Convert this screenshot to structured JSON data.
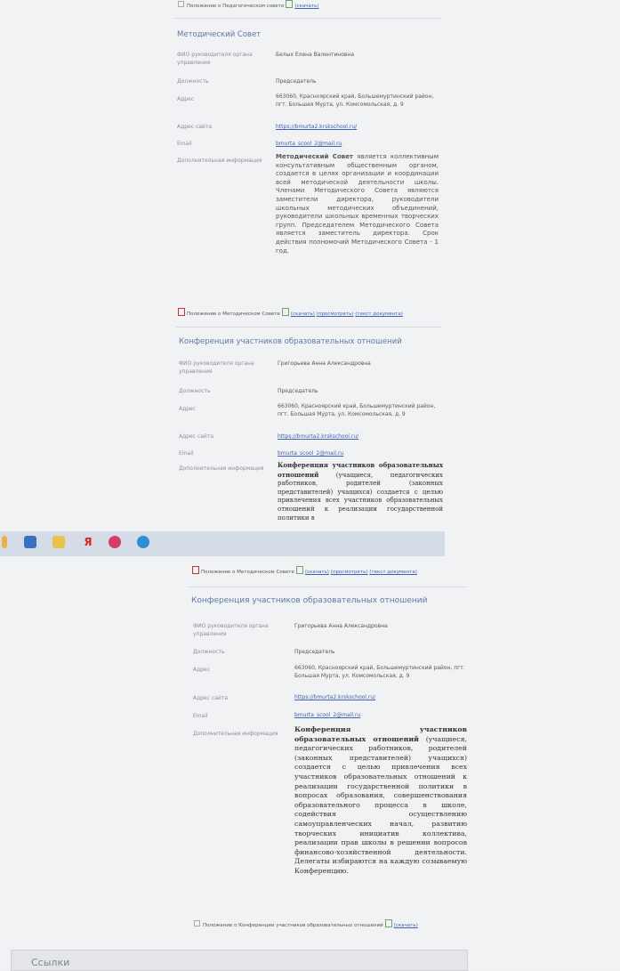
{
  "top_doc": {
    "label": "Положение о Педагогическом совете",
    "action": "(скачать)"
  },
  "metod": {
    "title": "Методический Совет",
    "rows": [
      {
        "label": "ФИО руководителя органа управления",
        "value": "Белых Елена Валентиновна"
      },
      {
        "label": "Должность",
        "value": "Председатель"
      },
      {
        "label": "Адрес",
        "value": "663060, Красноярский край, Большемуртинский район, пгт. Большая Мурта, ул. Комсомольская, д. 9"
      },
      {
        "label": "Адрес сайта",
        "value": "https://bmurta2.krskschool.ru/"
      },
      {
        "label": "Email",
        "value": "bmurta_scool_2@mail.ru"
      },
      {
        "label": "Дополнительная информация",
        "value_bold": "Методический Совет",
        "value": " является коллективным консультативным общественным органом, создается в целях организации и координации всей методической деятельности школы. Членами Методического Совета являются заместители директора, руководители школьных методических объединений, руководители школьных временных творческих групп. Председателем Методического Совета является заместитель директора. Срок действия полномочий Методического Совета - 1 год."
      }
    ],
    "doc": {
      "label": "Положение о Методическом Совете",
      "download": "(скачать)",
      "view": "(просмотреть)",
      "text": "(текст документа)"
    }
  },
  "konf1": {
    "title": "Конференция участников образовательных отношений",
    "rows": [
      {
        "label": "ФИО руководителя органа управления",
        "value": "Григорьева Анна Александровна"
      },
      {
        "label": "Должность",
        "value": "Председатель"
      },
      {
        "label": "Адрес",
        "value": "663060, Красноярский край, Большемуртинский район, пгт. Большая Мурта, ул. Комсомольская, д. 9"
      },
      {
        "label": "Адрес сайта",
        "value": "https://bmurta2.krskschool.ru/"
      },
      {
        "label": "Email",
        "value": "bmurta_scool_2@mail.ru"
      },
      {
        "label": "Дополнительная информация",
        "value_bold": "Конференция участников образовательных отношений",
        "value": " (учащиеся, педагогических работников, родителей (законных представителей) учащихся) создается с целью привлечения всех участников образовательных отношений к реализации государственной политики в"
      }
    ]
  },
  "taskbar": {
    "icons": [
      "pencil-icon",
      "monitor-icon",
      "folder-icon",
      "yandex-icon",
      "chrome-icon",
      "ie-icon"
    ]
  },
  "doc2": {
    "label": "Положение о Методическом Совете",
    "download": "(скачать)",
    "view": "(просмотреть)",
    "text": "(текст документа)"
  },
  "konf2": {
    "title": "Конференция участников образовательных отношений",
    "rows": [
      {
        "label": "ФИО руководителя органа управления",
        "value": "Григорьева Анна Александровна"
      },
      {
        "label": "Должность",
        "value": "Председатель"
      },
      {
        "label": "Адрес",
        "value": "663060, Красноярский край, Большемуртинский район, пгт. Большая Мурта, ул. Комсомольская, д. 9"
      },
      {
        "label": "Адрес сайта",
        "value": "https://bmurta2.krskschool.ru/"
      },
      {
        "label": "Email",
        "value": "bmurta_scool_2@mail.ru"
      },
      {
        "label": "Дополнительная информация",
        "value_bold": "Конференция участников образовательных отношений",
        "value": " (учащиеся, педагогических работников, родителей (законных представителей) учащихся) создается с целью привлечения всех участников образовательных отношений к реализации государственной политики в вопросах образования, совершенствования образовательного процесса в школе, содействия осуществлению самоуправленческих начал, развитию творческих инициатив коллектива, реализации прав школы в решении вопросов финансово-хозяйственной деятельности. Делегаты избираются на каждую созываемую Конференцию."
      }
    ],
    "doc": {
      "label": "Положение о Конференции участников образовательных отношений",
      "download": "(скачать)"
    }
  },
  "footer": {
    "title": "Ссылки"
  }
}
